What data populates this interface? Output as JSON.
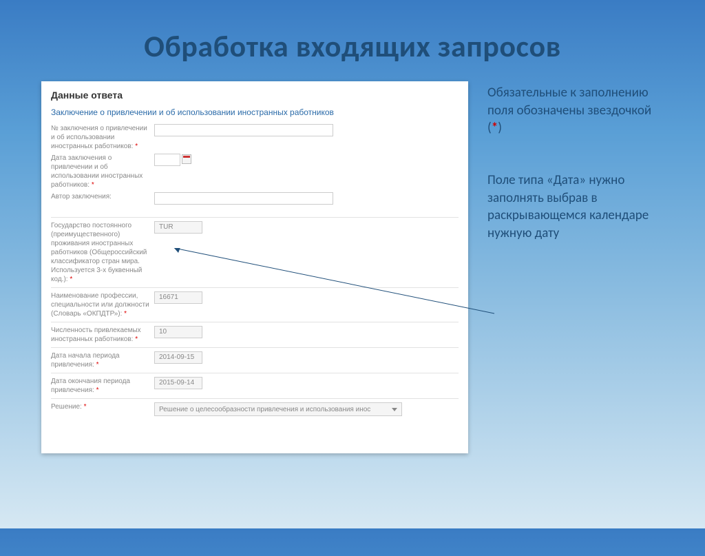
{
  "slide": {
    "title": "Обработка входящих запросов"
  },
  "annotations": {
    "required_prefix": "Обязательные к заполнению поля обозначены звездочкой (",
    "required_star": "*",
    "required_suffix": ")",
    "date_field": "Поле типа «Дата» нужно заполнять выбрав в раскрывающемся календаре нужную дату"
  },
  "form": {
    "section_title": "Данные ответа",
    "subtitle": "Заключение о привлечении и об использовании иностранных работников",
    "fields": {
      "conclusion_number_label": "№ заключения о привлечении и об использовании иностранных работников:",
      "conclusion_date_label": "Дата заключения о привлечении и об использовании иностранных работников:",
      "author_label": "Автор заключения:"
    },
    "table": {
      "country_label": "Государство постоянного (преимущественного) проживания иностранных работников (Общероссийский классификатор стран мира. Используется 3-х буквенный код.):",
      "country_value": "TUR",
      "profession_label": "Наименование профессии, специальности или должности (Словарь «ОКПДТР»):",
      "profession_value": "16671",
      "count_label": "Численность привлекаемых иностранных работников:",
      "count_value": "10",
      "start_date_label": "Дата начала периода привлечения:",
      "start_date_value": "2014-09-15",
      "end_date_label": "Дата окончания периода привлечения:",
      "end_date_value": "2015-09-14",
      "decision_label": "Решение:",
      "decision_value": "Решение о целесообразности привлечения и использования инос"
    }
  }
}
